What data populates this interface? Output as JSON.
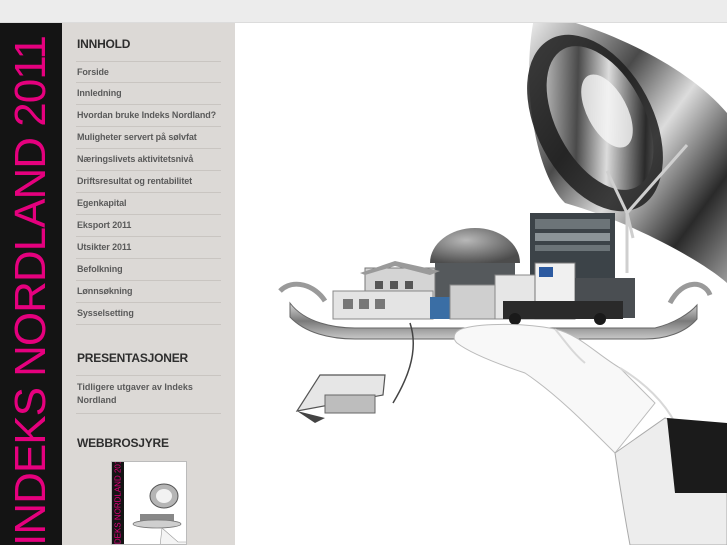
{
  "brand": {
    "title": "INDEKS NORDLAND 2011"
  },
  "sidebar": {
    "contents_heading": "INNHOLD",
    "contents_items": [
      "Forside",
      "Innledning",
      "Hvordan bruke Indeks Nordland?",
      "Muligheter servert på sølvfat",
      "Næringslivets aktivitetsnivå",
      "Driftsresultat og rentabilitet",
      "Egenkapital",
      "Eksport 2011",
      "Utsikter 2011",
      "Befolkning",
      "Lønnsøkning",
      "Sysselsetting"
    ],
    "presentations_heading": "PRESENTASJONER",
    "presentations_link": "Tidligere utgaver av Indeks Nordland",
    "brochure_heading": "WEBBROSJYRE",
    "brochure_title": "INDEKS NORDLAND 2011"
  },
  "colors": {
    "brand_pink": "#e5007e",
    "strip_black": "#141414",
    "sidebar_bg": "#dcd9d6"
  }
}
